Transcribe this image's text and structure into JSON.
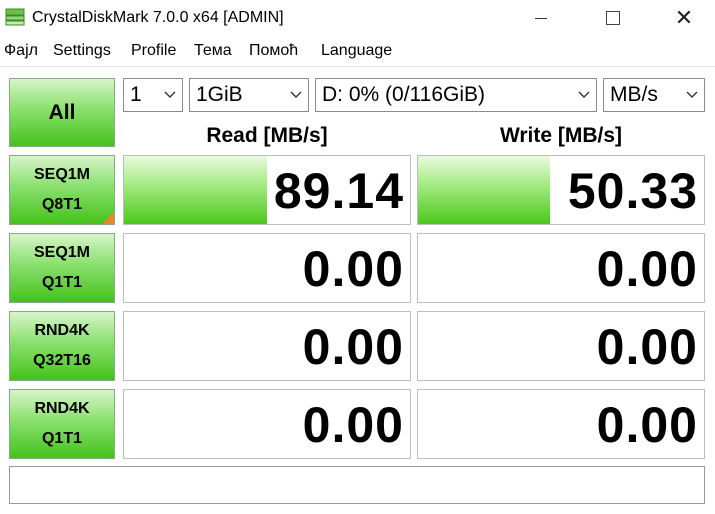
{
  "window": {
    "title": "CrystalDiskMark 7.0.0 x64 [ADMIN]",
    "minimize_icon": "minimize-icon",
    "maximize_icon": "maximize-icon",
    "close_glyph": "✕"
  },
  "menu": [
    "Фајл",
    "Settings",
    "Profile",
    "Тема",
    "Помоћ",
    "Language"
  ],
  "controls": {
    "all_label": "All",
    "count": "1",
    "size": "1GiB",
    "drive": "D: 0% (0/116GiB)",
    "unit": "MB/s"
  },
  "headers": {
    "read": "Read [MB/s]",
    "write": "Write [MB/s]"
  },
  "tests": [
    {
      "line1": "SEQ1M",
      "line2": "Q8T1",
      "read": "89.14",
      "write": "50.33",
      "read_fill": 0.5,
      "write_fill": 0.46,
      "active": true
    },
    {
      "line1": "SEQ1M",
      "line2": "Q1T1",
      "read": "0.00",
      "write": "0.00",
      "read_fill": 0,
      "write_fill": 0,
      "active": false
    },
    {
      "line1": "RND4K",
      "line2": "Q32T16",
      "read": "0.00",
      "write": "0.00",
      "read_fill": 0,
      "write_fill": 0,
      "active": false
    },
    {
      "line1": "RND4K",
      "line2": "Q1T1",
      "read": "0.00",
      "write": "0.00",
      "read_fill": 0,
      "write_fill": 0,
      "active": false
    }
  ],
  "status": ""
}
